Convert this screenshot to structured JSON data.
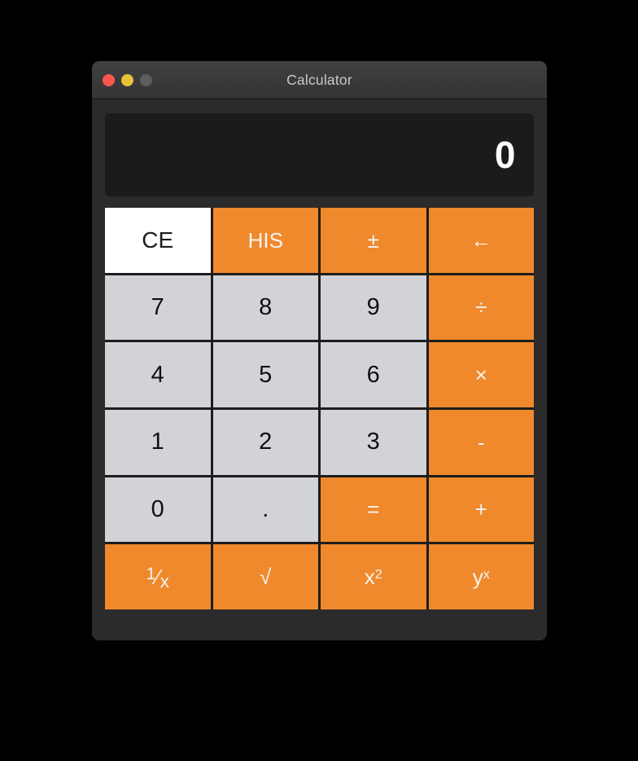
{
  "window": {
    "title": "Calculator",
    "traffic_lights": [
      {
        "name": "close",
        "color": "#fb564f"
      },
      {
        "name": "minimize",
        "color": "#e7c337"
      },
      {
        "name": "zoom",
        "color": "#5d5d5d"
      }
    ]
  },
  "display": {
    "value": "0"
  },
  "theme": {
    "operator_color": "#f0892c",
    "number_color": "#d2d3d7",
    "clear_color": "#ffffff",
    "display_bg": "#1b1b1b",
    "window_bg": "#2b2b2b"
  },
  "keypad": {
    "rows": [
      [
        {
          "label": "CE",
          "name": "clear-entry",
          "kind": "clear"
        },
        {
          "label": "HIS",
          "name": "history",
          "kind": "op"
        },
        {
          "label": "±",
          "name": "sign-toggle",
          "kind": "op"
        },
        {
          "label": "←",
          "name": "backspace",
          "kind": "op"
        }
      ],
      [
        {
          "label": "7",
          "name": "digit-7",
          "kind": "num"
        },
        {
          "label": "8",
          "name": "digit-8",
          "kind": "num"
        },
        {
          "label": "9",
          "name": "digit-9",
          "kind": "num"
        },
        {
          "label": "÷",
          "name": "divide",
          "kind": "op"
        }
      ],
      [
        {
          "label": "4",
          "name": "digit-4",
          "kind": "num"
        },
        {
          "label": "5",
          "name": "digit-5",
          "kind": "num"
        },
        {
          "label": "6",
          "name": "digit-6",
          "kind": "num"
        },
        {
          "label": "×",
          "name": "multiply",
          "kind": "op"
        }
      ],
      [
        {
          "label": "1",
          "name": "digit-1",
          "kind": "num"
        },
        {
          "label": "2",
          "name": "digit-2",
          "kind": "num"
        },
        {
          "label": "3",
          "name": "digit-3",
          "kind": "num"
        },
        {
          "label": "-",
          "name": "subtract",
          "kind": "op"
        }
      ],
      [
        {
          "label": "0",
          "name": "digit-0",
          "kind": "num"
        },
        {
          "label": ".",
          "name": "decimal",
          "kind": "num"
        },
        {
          "label": "=",
          "name": "equals",
          "kind": "op"
        },
        {
          "label": "+",
          "name": "add",
          "kind": "op"
        }
      ],
      [
        {
          "label": "1/x",
          "name": "reciprocal",
          "kind": "op"
        },
        {
          "label": "√",
          "name": "square-root",
          "kind": "op"
        },
        {
          "label": "x2",
          "name": "square",
          "kind": "op"
        },
        {
          "label": "yx",
          "name": "power",
          "kind": "op"
        }
      ]
    ]
  }
}
